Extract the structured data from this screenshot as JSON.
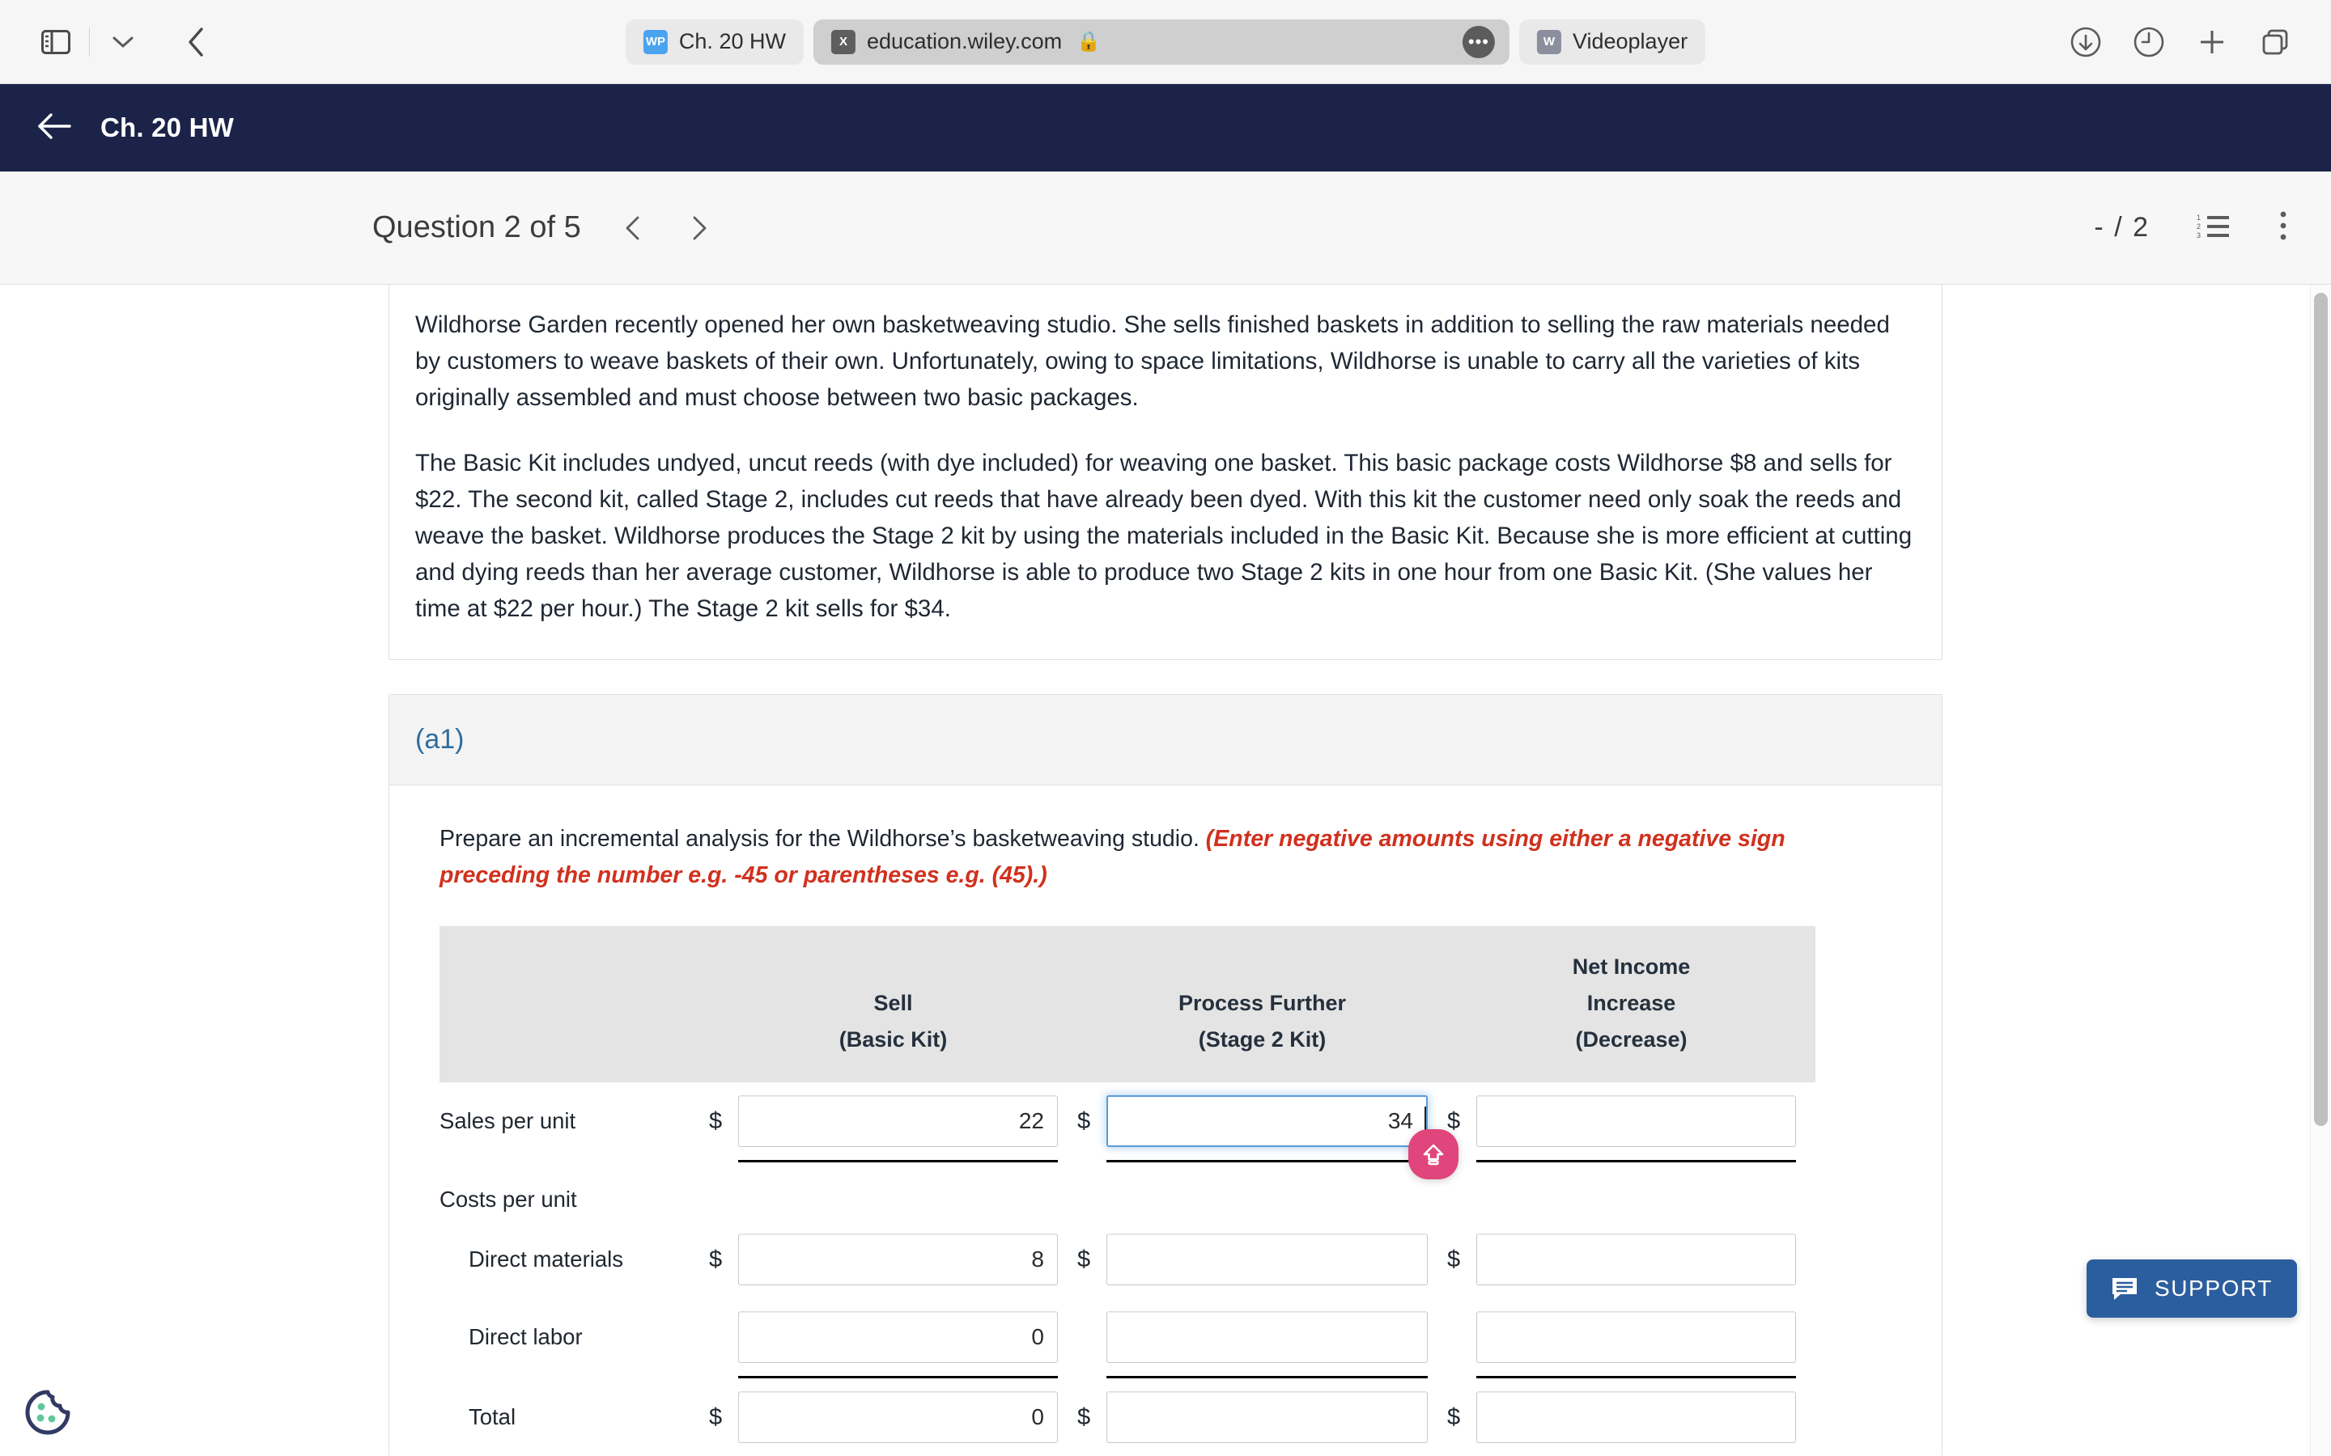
{
  "browser": {
    "left_controls": [
      {
        "name": "sidebar-toggle",
        "icon": "sidebar-icon"
      },
      {
        "name": "tab-group-chevron",
        "icon": "chevron-down-icon"
      },
      {
        "name": "back-button",
        "icon": "chevron-left-icon"
      }
    ],
    "tabs": [
      {
        "favicon_label": "WP",
        "favicon_kind": "wp",
        "title": "Ch. 20 HW",
        "active": false,
        "secure": false
      },
      {
        "favicon_label": "X",
        "favicon_kind": "x",
        "title": "education.wiley.com",
        "active": true,
        "secure": true,
        "more_label": "•••"
      },
      {
        "favicon_label": "W",
        "favicon_kind": "w",
        "title": "Videoplayer",
        "active": false,
        "secure": false
      }
    ],
    "right_controls": [
      {
        "name": "downloads-icon"
      },
      {
        "name": "history-clock-icon"
      },
      {
        "name": "new-tab-icon"
      },
      {
        "name": "tab-overview-icon"
      }
    ]
  },
  "app_header": {
    "back_label": "back",
    "title": "Ch. 20 HW",
    "background": "#1b2348"
  },
  "question_bar": {
    "title": "Question 2 of 5",
    "prev_label": "previous question",
    "next_label": "next question",
    "score": "- / 2",
    "list_icon": "numbered-list-icon",
    "menu_icon": "kebab-menu-icon"
  },
  "prompt": {
    "paragraphs": [
      "Wildhorse Garden recently opened her own basketweaving studio. She sells finished baskets in addition to selling the raw materials needed by customers to weave baskets of their own. Unfortunately, owing to space limitations, Wildhorse is unable to carry all the varieties of kits originally assembled and must choose between two basic packages.",
      "The Basic Kit includes undyed, uncut reeds (with dye included) for weaving one basket. This basic package costs Wildhorse $8 and sells for $22. The second kit, called Stage 2, includes cut reeds that have already been dyed. With this kit the customer need only soak the reeds and weave the basket. Wildhorse produces the Stage 2 kit by using the materials included in the Basic Kit. Because she is more efficient at cutting and dying reeds than her average customer, Wildhorse is able to produce two Stage 2 kits in one hour from one Basic Kit. (She values her time at $22 per hour.) The Stage 2 kit sells for $34."
    ]
  },
  "part": {
    "label": "(a1)",
    "instruction_plain": "Prepare an incremental analysis for the Wildhorse’s basketweaving studio. ",
    "instruction_warning": "(Enter negative amounts using either a negative sign preceding the number e.g. -45 or parentheses e.g. (45).)"
  },
  "table": {
    "columns": [
      {
        "line1": "",
        "line2": "Sell",
        "line3": "(Basic Kit)"
      },
      {
        "line1": "",
        "line2": "Process Further",
        "line3": "(Stage 2 Kit)"
      },
      {
        "line1": "Net Income",
        "line2": "Increase",
        "line3": "(Decrease)"
      }
    ],
    "rows": [
      {
        "label": "Sales per unit",
        "indent": false,
        "has_inputs": true,
        "rule_below": true,
        "cells": [
          {
            "dollar": "$",
            "value": "22",
            "focused": false
          },
          {
            "dollar": "$",
            "value": "34",
            "focused": true
          },
          {
            "dollar": "$",
            "value": "",
            "focused": false
          }
        ]
      },
      {
        "label": "Costs per unit",
        "indent": false,
        "has_inputs": false,
        "rule_below": false,
        "cells": []
      },
      {
        "label": "Direct materials",
        "indent": true,
        "has_inputs": true,
        "rule_below": false,
        "cells": [
          {
            "dollar": "$",
            "value": "8",
            "focused": false
          },
          {
            "dollar": "$",
            "value": "",
            "focused": false
          },
          {
            "dollar": "$",
            "value": "",
            "focused": false
          }
        ]
      },
      {
        "label": "Direct labor",
        "indent": true,
        "has_inputs": true,
        "rule_below": true,
        "cells": [
          {
            "dollar": "",
            "value": "0",
            "focused": false
          },
          {
            "dollar": "",
            "value": "",
            "focused": false
          },
          {
            "dollar": "",
            "value": "",
            "focused": false
          }
        ]
      },
      {
        "label": "Total",
        "indent": true,
        "has_inputs": true,
        "rule_below": false,
        "cells": [
          {
            "dollar": "$",
            "value": "0",
            "focused": false
          },
          {
            "dollar": "$",
            "value": "",
            "focused": false
          },
          {
            "dollar": "$",
            "value": "",
            "focused": false
          }
        ]
      }
    ]
  },
  "overlays": {
    "shift_badge": {
      "name": "shift-key-indicator",
      "color": "#e0457b"
    },
    "support": {
      "label": "SUPPORT",
      "icon": "chat-bubble-icon",
      "color": "#2b5e9e"
    },
    "cookie": {
      "name": "cookie-settings-icon",
      "outline": "#323a64",
      "chip": "#5fc79a"
    }
  }
}
